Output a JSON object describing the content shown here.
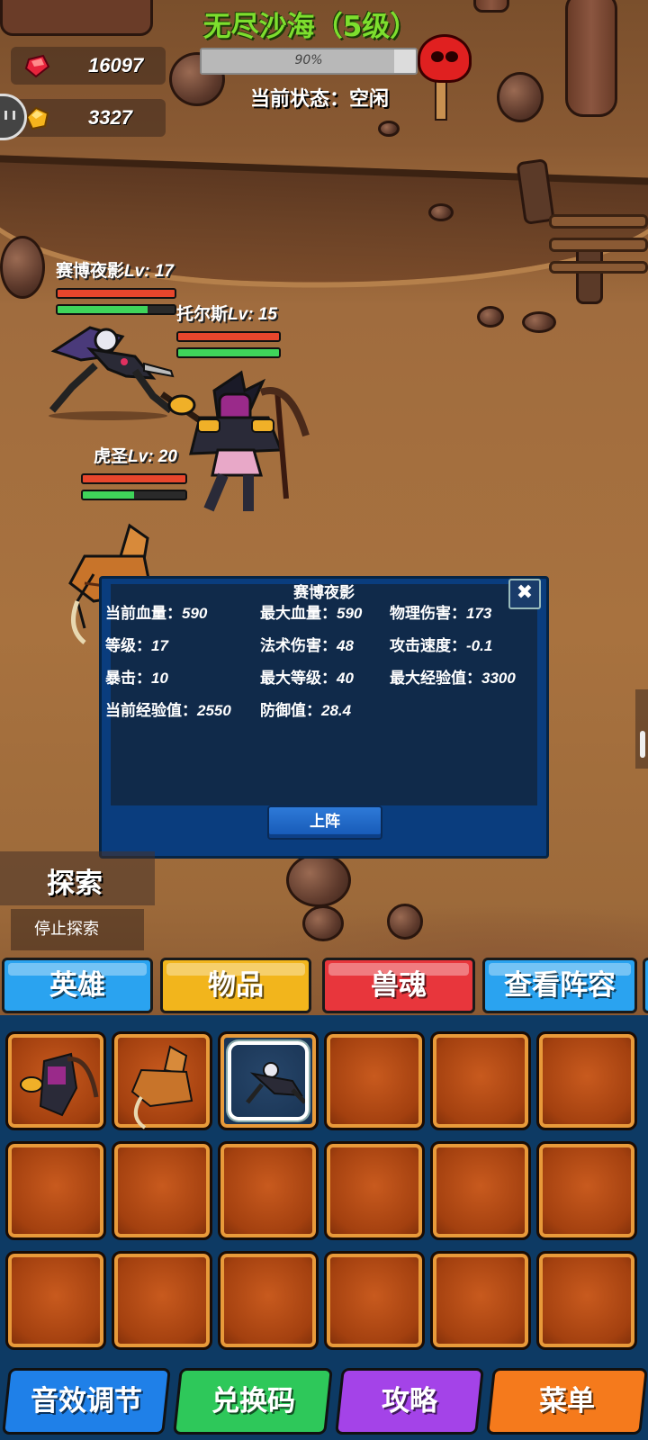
{
  "hud": {
    "gems": "16097",
    "gold": "3327",
    "stage_title": "无尽沙海（5级）",
    "progress_label": "90%",
    "progress_pct": 90,
    "status": "当前状态：空闲"
  },
  "heroes": [
    {
      "name": "赛博夜影",
      "lv": "Lv: 17",
      "hp_pct": 100,
      "xp_pct": 77
    },
    {
      "name": "托尔斯",
      "lv": "Lv: 15",
      "hp_pct": 100,
      "xp_pct": 100
    },
    {
      "name": "虎圣",
      "lv": "Lv: 20",
      "hp_pct": 100,
      "xp_pct": 50
    }
  ],
  "dialog": {
    "title": "赛博夜影",
    "close_icon": "✖",
    "stats": [
      {
        "label": "当前血量：",
        "value": "590"
      },
      {
        "label": "最大血量：",
        "value": "590"
      },
      {
        "label": "物理伤害：",
        "value": "173"
      },
      {
        "label": "等级：",
        "value": "17"
      },
      {
        "label": "法术伤害：",
        "value": "48"
      },
      {
        "label": "攻击速度：",
        "value": "-0.1"
      },
      {
        "label": "暴击：",
        "value": "10"
      },
      {
        "label": "最大等级：",
        "value": "40"
      },
      {
        "label": "最大经验值：",
        "value": "3300"
      },
      {
        "label": "当前经验值：",
        "value": "2550"
      },
      {
        "label": "防御值：",
        "value": "28.4"
      }
    ],
    "deploy_label": "上阵"
  },
  "explore": {
    "title": "探索",
    "stop_label": "停止探索"
  },
  "tabs": [
    {
      "label": "英雄",
      "color": "#2aa3f0"
    },
    {
      "label": "物品",
      "color": "#f2b51c"
    },
    {
      "label": "兽魂",
      "color": "#e8363c"
    },
    {
      "label": "查看阵容",
      "color": "#2aa3f0"
    }
  ],
  "bottom_buttons": [
    {
      "label": "音效调节",
      "color": "#1f80e8"
    },
    {
      "label": "兑换码",
      "color": "#2ec85a"
    },
    {
      "label": "攻略",
      "color": "#a443e8"
    },
    {
      "label": "菜单",
      "color": "#f57a1c"
    }
  ]
}
